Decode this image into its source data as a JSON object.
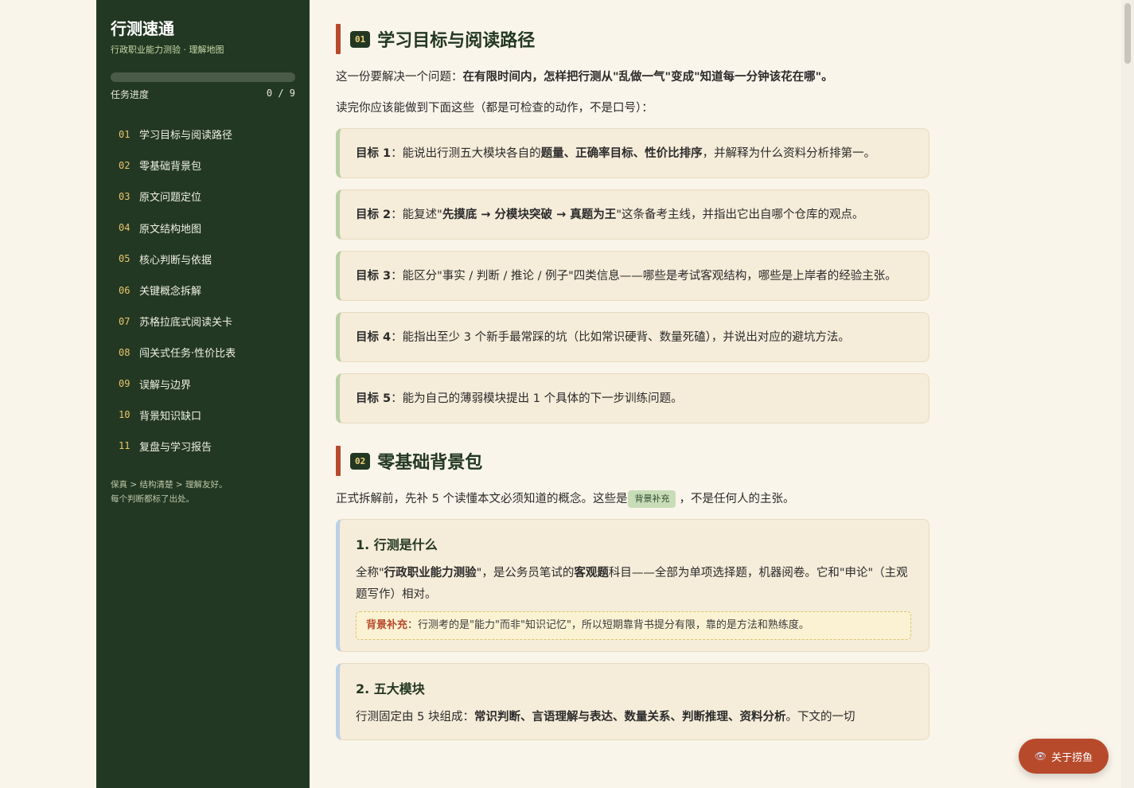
{
  "sidebar": {
    "title": "行测速通",
    "subtitle": "行政职业能力测验 · 理解地图",
    "progress_label": "任务进度",
    "progress_count": "0 / 9",
    "progress_fraction": 0,
    "items": [
      {
        "num": "01",
        "label": "学习目标与阅读路径"
      },
      {
        "num": "02",
        "label": "零基础背景包"
      },
      {
        "num": "03",
        "label": "原文问题定位"
      },
      {
        "num": "04",
        "label": "原文结构地图"
      },
      {
        "num": "05",
        "label": "核心判断与依据"
      },
      {
        "num": "06",
        "label": "关键概念拆解"
      },
      {
        "num": "07",
        "label": "苏格拉底式阅读关卡"
      },
      {
        "num": "08",
        "label": "闯关式任务·性价比表"
      },
      {
        "num": "09",
        "label": "误解与边界"
      },
      {
        "num": "10",
        "label": "背景知识缺口"
      },
      {
        "num": "11",
        "label": "复盘与学习报告"
      }
    ],
    "note_line1": "保真 > 结构清楚 > 理解友好。",
    "note_line2": "每个判断都标了出处。"
  },
  "section1": {
    "badge": "01",
    "title": "学习目标与阅读路径",
    "intro_pre": "这一份要解决一个问题：",
    "intro_bold": "在有限时间内，怎样把行测从\"乱做一气\"变成\"知道每一分钟该花在哪\"。",
    "intro2": "读完你应该能做到下面这些（都是可检查的动作，不是口号）：",
    "goals": [
      {
        "label": "目标 1",
        "p1": "：能说出行测五大模块各自的",
        "b1": "题量、正确率目标、性价比排序",
        "p2": "，并解释为什么资料分析排第一。"
      },
      {
        "label": "目标 2",
        "p1": "：能复述\"",
        "b1": "先摸底 → 分模块突破 → 真题为王",
        "p2": "\"这条备考主线，并指出它出自哪个仓库的观点。"
      },
      {
        "label": "目标 3",
        "p1": "：能区分\"事实 / 判断 / 推论 / 例子\"四类信息——哪些是考试客观结构，哪些是上岸者的经验主张。"
      },
      {
        "label": "目标 4",
        "p1": "：能指出至少 3 个新手最常踩的坑（比如常识硬背、数量死磕），并说出对应的避坑方法。"
      },
      {
        "label": "目标 5",
        "p1": "：能为自己的薄弱模块提出 1 个具体的下一步训练问题。"
      }
    ]
  },
  "section2": {
    "badge": "02",
    "title": "零基础背景包",
    "intro_pre": "正式拆解前，先补 5 个读懂本文必须知道的概念。这些是",
    "tag": "背景补充",
    "intro_post": "，不是任何人的主张。",
    "cards": [
      {
        "title": "1. 行测是什么",
        "p1": "全称\"",
        "b1": "行政职业能力测验",
        "p2": "\"，是公务员笔试的",
        "b2": "客观题",
        "p3": "科目——全部为单项选择题，机器阅卷。它和\"申论\"（主观题写作）相对。",
        "note_label": "背景补充",
        "note_text": "：行测考的是\"能力\"而非\"知识记忆\"，所以短期靠背书提分有限，靠的是方法和熟练度。"
      },
      {
        "title": "2. 五大模块",
        "p1": "行测固定由 5 块组成：",
        "b1": "常识判断、言语理解与表达、数量关系、判断推理、资料分析",
        "p2": "。下文的一切"
      }
    ]
  },
  "fab": {
    "icon": "eye-icon",
    "label": "关于捞鱼"
  }
}
